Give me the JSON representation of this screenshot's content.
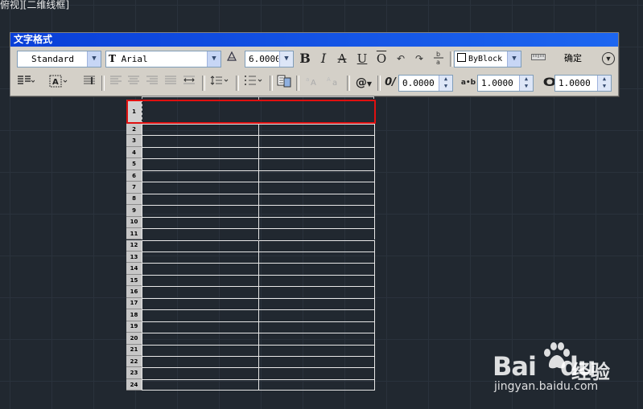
{
  "viewport": {
    "label": "俯视][二维线框]"
  },
  "toolbar": {
    "title": "文字格式",
    "style": "Standard",
    "font": "Arial",
    "font_prefix_icon": "truetype-icon",
    "height": "6.0000",
    "bold": "B",
    "italic": "I",
    "strike": "A",
    "underline": "U",
    "overline": "O",
    "color": "ByBlock",
    "ok_label": "确定",
    "oblique": "0.0000",
    "tracking": "1.0000",
    "width_factor": "1.0000",
    "symbol": "@",
    "oblique_glyph": "0/",
    "tracking_glyph": "a•b",
    "width_glyph": "O"
  },
  "table": {
    "row_numbers": [
      "1",
      "2",
      "3",
      "4",
      "5",
      "6",
      "7",
      "8",
      "9",
      "10",
      "11",
      "12",
      "13",
      "14",
      "15",
      "16",
      "17",
      "18",
      "19",
      "20",
      "21",
      "22",
      "23",
      "24"
    ],
    "selected_row": "1"
  },
  "watermark": {
    "brand": "Bai",
    "brand_du": "du",
    "cn": "经验",
    "url": "jingyan.baidu.com"
  }
}
